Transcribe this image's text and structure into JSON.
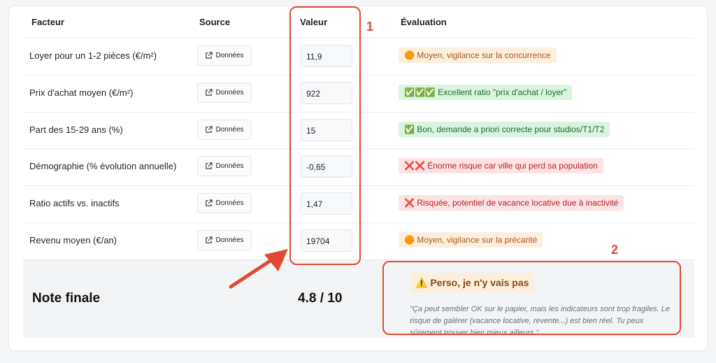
{
  "headers": {
    "factor": "Facteur",
    "source": "Source",
    "value": "Valeur",
    "evaluation": "Évaluation"
  },
  "rows": [
    {
      "factor": "Loyer pour un 1-2 pièces (€/m²)",
      "source_label": "Données",
      "value": "11,9",
      "evaluation": "🟠 Moyen, vigilance sur la concurrence",
      "status": "orange"
    },
    {
      "factor": "Prix d'achat moyen (€/m²)",
      "source_label": "Données",
      "value": "922",
      "evaluation": "✅✅✅ Excellent ratio \"prix d'achat / loyer\"",
      "status": "green"
    },
    {
      "factor": "Part des 15-29 ans (%)",
      "source_label": "Données",
      "value": "15",
      "evaluation": "✅ Bon, demande a priori correcte pour studios/T1/T2",
      "status": "green"
    },
    {
      "factor": "Démographie (% évolution annuelle)",
      "source_label": "Données",
      "value": "-0,65",
      "evaluation": "❌❌ Énorme risque car ville qui perd sa population",
      "status": "red"
    },
    {
      "factor": "Ratio actifs vs. inactifs",
      "source_label": "Données",
      "value": "1,47",
      "evaluation": "❌ Risquée, potentiel de vacance locative due à inactivité",
      "status": "red"
    },
    {
      "factor": "Revenu moyen (€/an)",
      "source_label": "Données",
      "value": "19704",
      "evaluation": "🟠 Moyen, vigilance sur la précarité",
      "status": "orange"
    }
  ],
  "final": {
    "label": "Note finale",
    "score": "4.8 / 10",
    "verdict": "⚠️ Perso, je n'y vais pas",
    "quote": "\"Ça peut sembler OK sur le papier, mais les indicateurs sont trop fragiles. Le risque de galérer (vacance locative, revente...) est bien réel. Tu peux sûrement trouver bien mieux ailleurs.\""
  },
  "annotations": {
    "one": "1",
    "two": "2"
  },
  "icons": {
    "source_button": "external-link-icon"
  },
  "colors": {
    "annotation": "#e04a33",
    "orange_bg": "#fcefdc",
    "green_bg": "#d9f5de",
    "red_bg": "#fde3e3"
  }
}
